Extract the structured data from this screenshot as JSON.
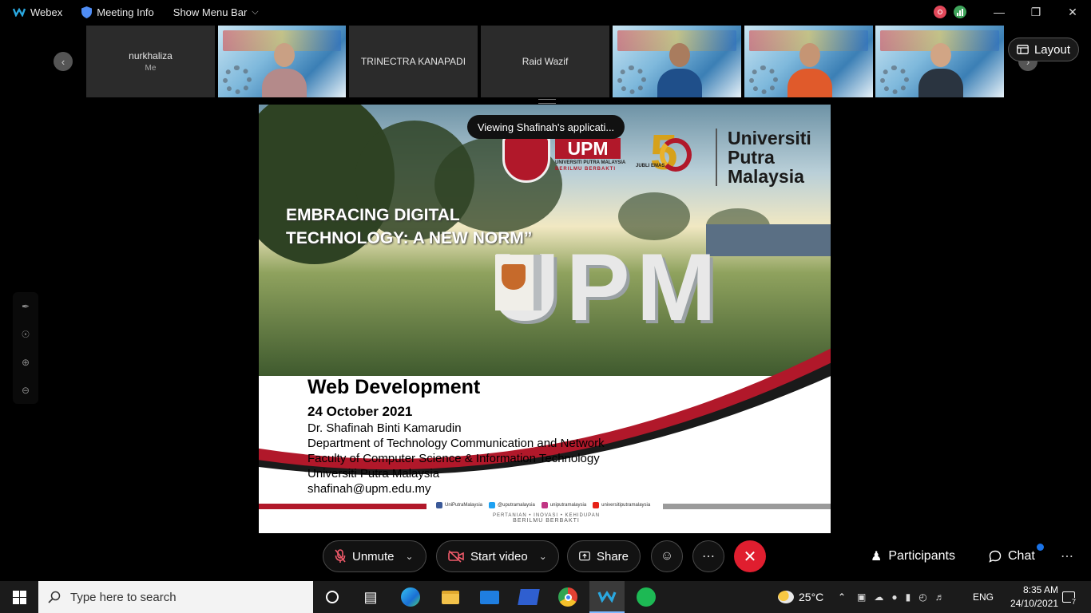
{
  "titlebar": {
    "app_name": "Webex",
    "meeting_info": "Meeting Info",
    "show_menu_bar": "Show Menu Bar"
  },
  "participants": [
    {
      "name": "nurkhaliza",
      "sub": "Me"
    },
    {
      "name": "TRINECTRA KANAPADI"
    },
    {
      "name": "Raid Wazif"
    }
  ],
  "layout_button": "Layout",
  "toast": "Viewing Shafinah's applicati...",
  "slide": {
    "heading_line1": "EMBRACING DIGITAL",
    "heading_line2": "TECHNOLOGY: A NEW NORM”",
    "photo_letters": "UPM",
    "logo_upm": "UPM",
    "logo_upm_sub": "UNIVERSITI PUTRA MALAYSIA",
    "logo_upm_motto": "BERILMU BERBAKTI",
    "jubli_digit": "5",
    "jubli_text": "JUBLI EMAS",
    "uni_line1": "Universiti",
    "uni_line2": "Putra",
    "uni_line3": "Malaysia",
    "title": "Web Development",
    "date": "24 October 2021",
    "presenter": "Dr. Shafinah Binti Kamarudin",
    "department": "Department of Technology Communication and Network",
    "faculty": "Faculty of Computer Science & Information Technology",
    "university": "Universiti Putra Malaysia",
    "email": "shafinah@upm.edu.my",
    "socials": [
      {
        "label": "UniPutraMalaysia",
        "color": "#3b5998"
      },
      {
        "label": "@uputramalaysia",
        "color": "#1da1f2"
      },
      {
        "label": "uniputramalaysia",
        "color": "#c13584"
      },
      {
        "label": "universitiputramalaysia",
        "color": "#e62117"
      }
    ],
    "motto_line1": "PERTANIAN • INOVASI • KEHIDUPAN",
    "motto_line2": "BERILMU BERBAKTI"
  },
  "controls": {
    "unmute": "Unmute",
    "start_video": "Start video",
    "share": "Share",
    "participants": "Participants",
    "chat": "Chat"
  },
  "taskbar": {
    "search_placeholder": "Type here to search",
    "weather": "25°C",
    "language": "ENG",
    "time": "8:35 AM",
    "date": "24/10/2021",
    "notification_count": "7"
  }
}
